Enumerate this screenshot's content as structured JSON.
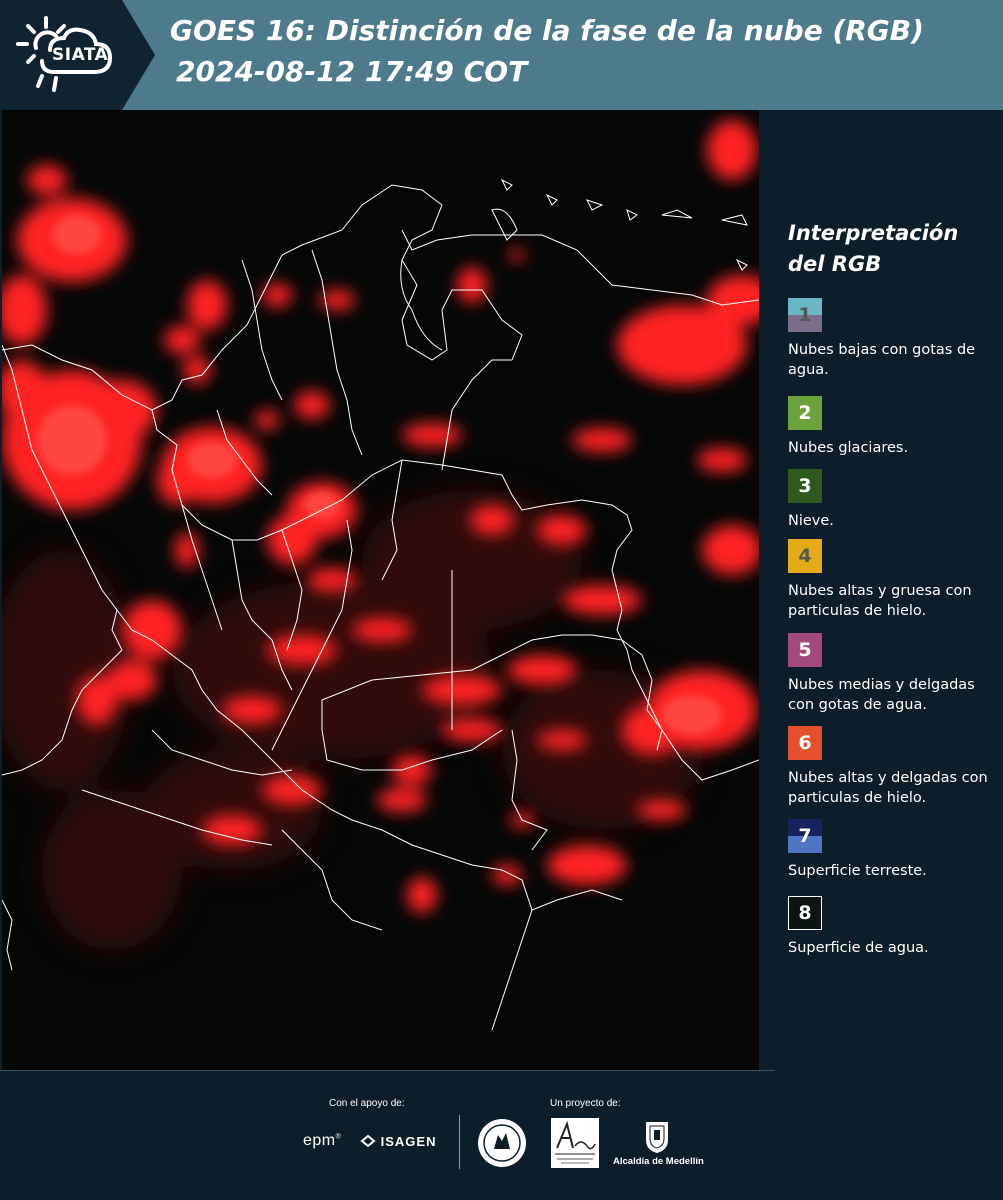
{
  "header": {
    "logo_text": "SIATA",
    "title_line1": "GOES 16: Distinción de la fase de la nube (RGB)",
    "title_line2": "2024-08-12 17:49 COT",
    "background_color": "#4e7b8c"
  },
  "map": {
    "description_icon": "satellite-rgb-map",
    "cloud_color": "#ff2a2a",
    "border_color": "#ffffff",
    "background_color": "#060808"
  },
  "legend": {
    "title": "Interpretación del RGB",
    "items": [
      {
        "number": "1",
        "label": "Nubes bajas con gotas de agua.",
        "color_top": "#6bb6c4",
        "color_bottom": "#7b6e8a"
      },
      {
        "number": "2",
        "label": "Nubes glaciares.",
        "color_top": "#6ca33a",
        "color_bottom": "#6ca33a"
      },
      {
        "number": "3",
        "label": "Nieve.",
        "color_top": "#2f5a1f",
        "color_bottom": "#2f5a1f"
      },
      {
        "number": "4",
        "label": "Nubes altas y gruesa con particulas de hielo.",
        "color_top": "#e3ac17",
        "color_bottom": "#e3ac17"
      },
      {
        "number": "5",
        "label": "Nubes medias y delgadas con gotas de agua.",
        "color_top": "#a24a7c",
        "color_bottom": "#a24a7c"
      },
      {
        "number": "6",
        "label": "Nubes altas y delgadas con particulas de hielo.",
        "color_top": "#e5502c",
        "color_bottom": "#e5502c"
      },
      {
        "number": "7",
        "label": "Superficie terreste.",
        "color_top": "#16235c",
        "color_bottom": "#4f74c2"
      },
      {
        "number": "8",
        "label": "Superficie de agua.",
        "color_top": "#0b1410",
        "color_bottom": "#0b1410"
      }
    ]
  },
  "footer": {
    "support_label": "Con el apoyo de:",
    "project_label": "Un proyecto de:",
    "sponsors": [
      "epm",
      "ISAGEN"
    ],
    "partners": [
      "Área Metropolitana Valle de Aburrá",
      "Alcaldía de Medellín"
    ],
    "alcaldia_label": "Alcaldía de Medellín"
  }
}
